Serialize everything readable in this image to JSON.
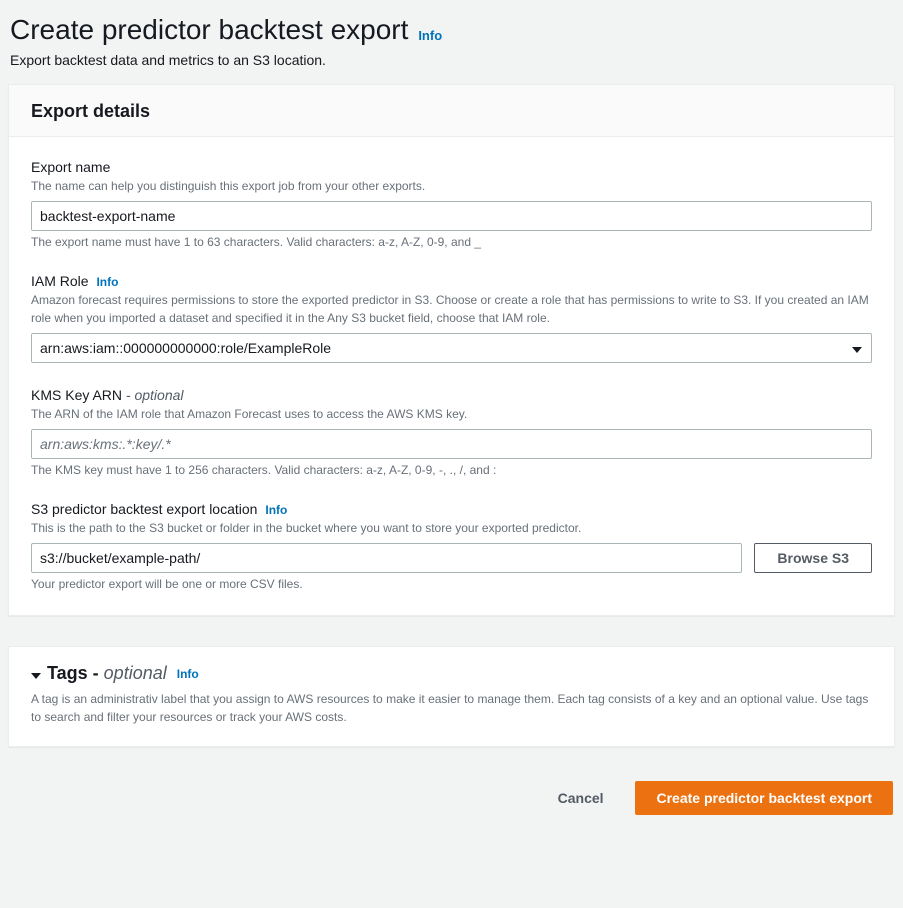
{
  "page": {
    "title": "Create predictor backtest export",
    "title_info": "Info",
    "subtitle": "Export backtest data and metrics to an S3 location."
  },
  "export_details": {
    "panel_title": "Export details",
    "export_name": {
      "label": "Export name",
      "desc": "The name can help you distinguish this export job from your other exports.",
      "value": "backtest-export-name",
      "constraint": "The export name must have 1 to 63 characters. Valid characters: a-z, A-Z, 0-9, and _"
    },
    "iam_role": {
      "label": "IAM Role",
      "info": "Info",
      "desc": "Amazon forecast requires permissions to store the exported predictor in S3. Choose or create a role that has permissions to write to S3. If you created an IAM role when you imported a dataset and specified it in the Any S3 bucket field, choose that IAM role.",
      "value": "arn:aws:iam::000000000000:role/ExampleRole"
    },
    "kms_key": {
      "label": "KMS Key ARN",
      "optional": "- optional",
      "desc": "The ARN of the IAM role that Amazon Forecast uses to access the AWS KMS key.",
      "placeholder": "arn:aws:kms:.*:key/.*",
      "value": "",
      "constraint": "The KMS key must have 1 to 256 characters. Valid characters: a-z, A-Z, 0-9, -, ., /, and :"
    },
    "s3_location": {
      "label": "S3 predictor backtest export location",
      "info": "Info",
      "desc": "This is the path to the S3 bucket or folder in the bucket where you want to store your exported predictor.",
      "value": "s3://bucket/example-path/",
      "browse_label": "Browse S3",
      "constraint": "Your predictor export will be one or more CSV files."
    }
  },
  "tags": {
    "title_prefix": "Tags - ",
    "optional": "optional",
    "info": "Info",
    "desc": "A tag is an administrativ label that you assign to AWS resources to make it easier to manage them. Each tag consists of a key and an optional value. Use tags to search and filter your resources or track your AWS costs."
  },
  "actions": {
    "cancel": "Cancel",
    "create": "Create predictor backtest export"
  }
}
